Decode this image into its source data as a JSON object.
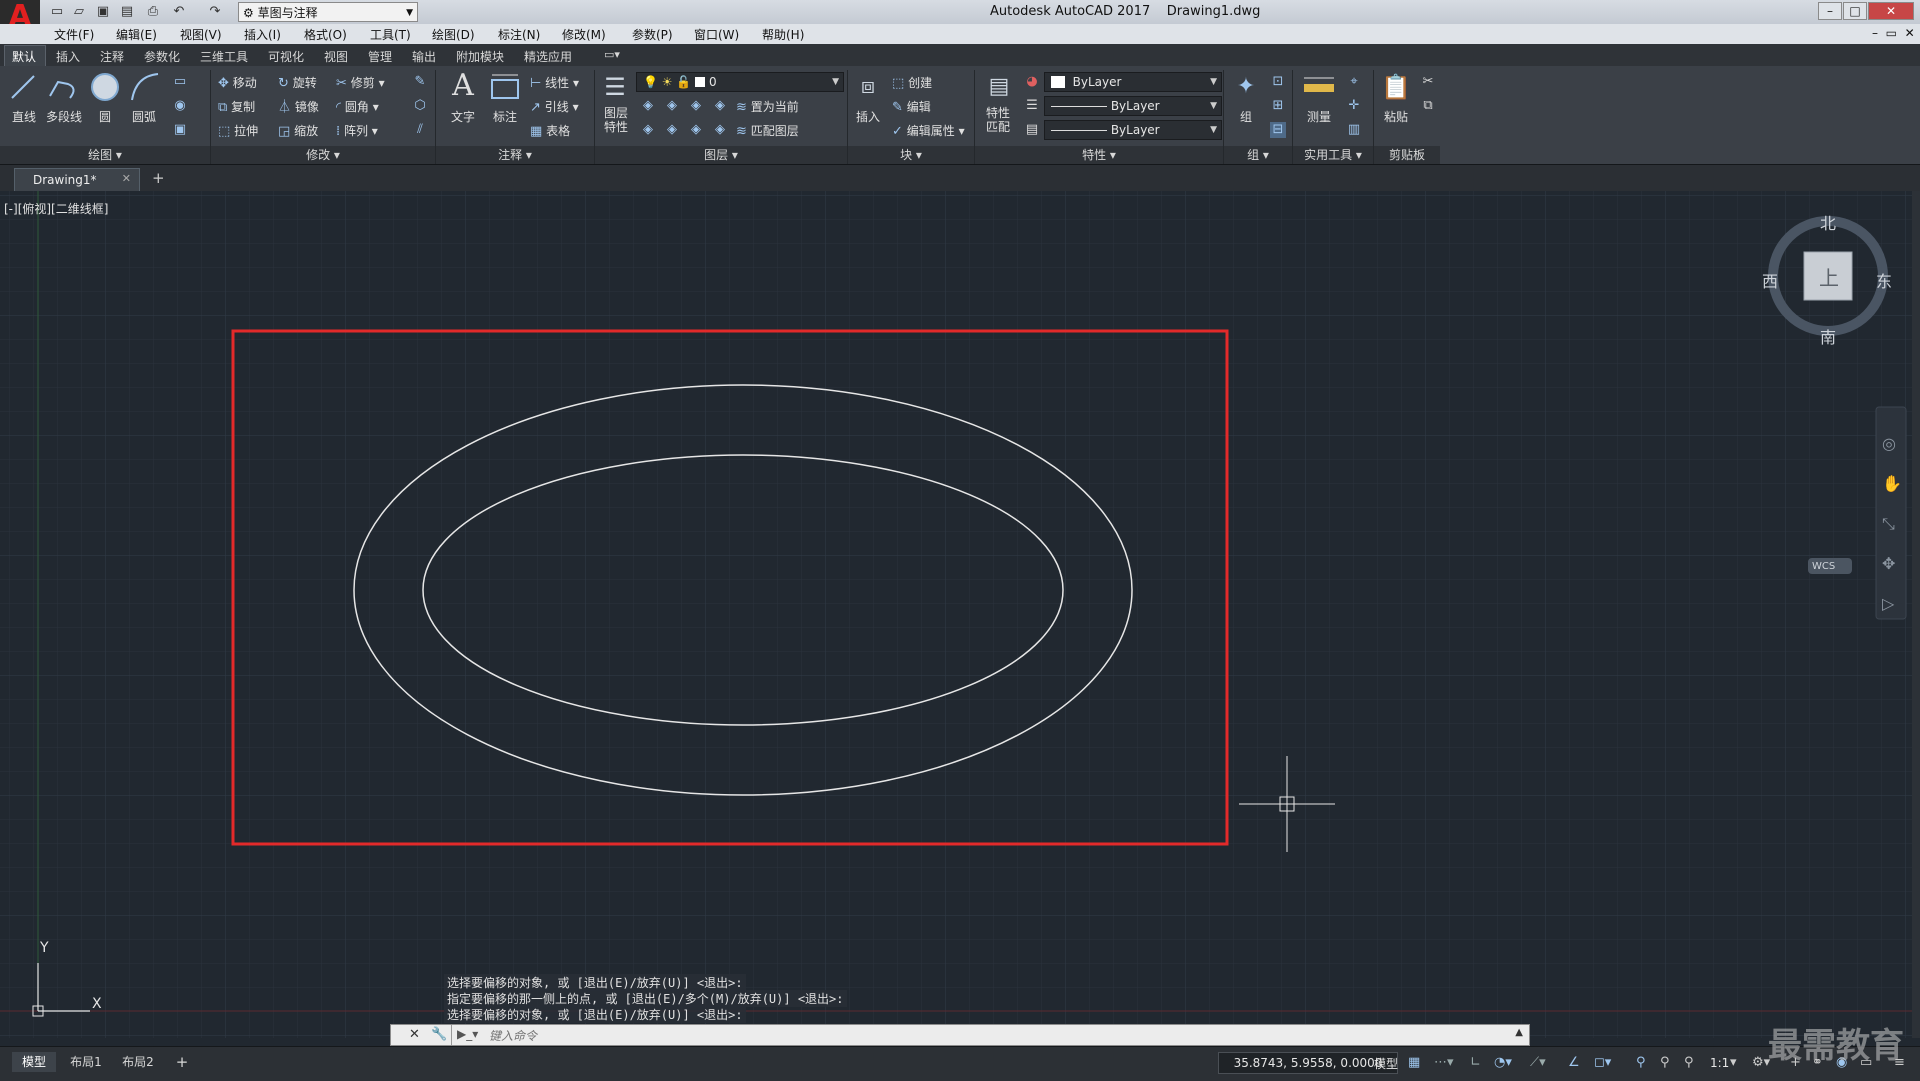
{
  "titlebar": {
    "logo": "A",
    "workspace": "草图与注释",
    "app_title": "Autodesk AutoCAD 2017",
    "doc_title": "Drawing1.dwg"
  },
  "menu": [
    "文件(F)",
    "编辑(E)",
    "视图(V)",
    "插入(I)",
    "格式(O)",
    "工具(T)",
    "绘图(D)",
    "标注(N)",
    "修改(M)",
    "参数(P)",
    "窗口(W)",
    "帮助(H)"
  ],
  "ribbon_tabs": [
    "默认",
    "插入",
    "注释",
    "参数化",
    "三维工具",
    "可视化",
    "视图",
    "管理",
    "输出",
    "附加模块",
    "精选应用"
  ],
  "ribbon": {
    "draw": {
      "title": "绘图",
      "line": "直线",
      "polyline": "多段线",
      "circle": "圆",
      "arc": "圆弧"
    },
    "modify": {
      "title": "修改",
      "move": "移动",
      "rotate": "旋转",
      "trim": "修剪",
      "copy": "复制",
      "mirror": "镜像",
      "fillet": "圆角",
      "stretch": "拉伸",
      "scale": "缩放",
      "array": "阵列"
    },
    "annotation": {
      "title": "注释",
      "text": "文字",
      "dimension": "标注",
      "linear": "线性",
      "leader": "引线",
      "table": "表格"
    },
    "layers": {
      "title": "图层",
      "layer_props": "图层\n特性",
      "current_layer": "0",
      "set_current": "置为当前",
      "match_layer": "匹配图层"
    },
    "block": {
      "title": "块",
      "insert": "插入",
      "create": "创建",
      "edit": "编辑",
      "edit_attr": "编辑属性"
    },
    "properties": {
      "title": "特性",
      "match": "特性\n匹配",
      "color": "ByLayer",
      "linetype": "ByLayer",
      "lineweight": "ByLayer"
    },
    "groups": {
      "title": "组",
      "group": "组"
    },
    "utilities": {
      "title": "实用工具",
      "measure": "测量"
    },
    "clipboard": {
      "title": "剪贴板",
      "paste": "粘贴"
    }
  },
  "doc_tab": "Drawing1*",
  "viewport_label": "[-][俯视][二维线框]",
  "viewcube": {
    "north": "北",
    "south": "南",
    "west": "西",
    "east": "东",
    "top": "上",
    "wcs": "WCS"
  },
  "ucs": {
    "x": "X",
    "y": "Y"
  },
  "command_history": [
    "选择要偏移的对象, 或 [退出(E)/放弃(U)] <退出>:",
    "指定要偏移的那一侧上的点, 或 [退出(E)/多个(M)/放弃(U)] <退出>:",
    "选择要偏移的对象, 或 [退出(E)/放弃(U)] <退出>:"
  ],
  "command_placeholder": "键入命令",
  "layout_tabs": [
    "模型",
    "布局1",
    "布局2"
  ],
  "status": {
    "coords": "35.8743, 5.9558, 0.0000",
    "mode": "模型",
    "scale": "1:1"
  },
  "watermark": "最需教育",
  "colors": {
    "canvas": "#212830",
    "highlight_rect": "#e32a2a",
    "ellipse": "#e6e6e6",
    "ribbon": "#3b4047"
  }
}
